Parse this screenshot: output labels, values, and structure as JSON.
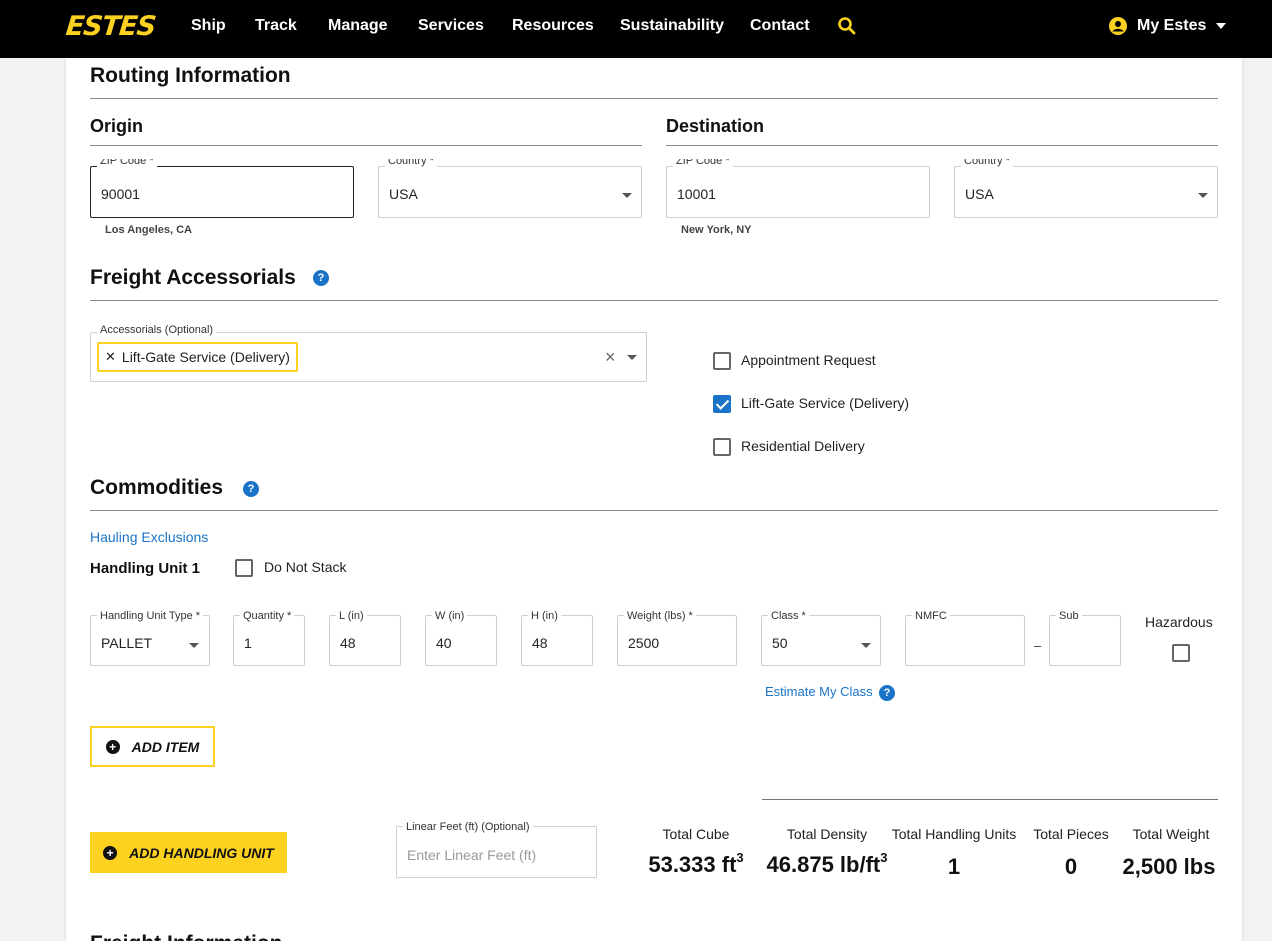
{
  "nav": {
    "logo": "ESTES",
    "links": [
      "Ship",
      "Track",
      "Manage",
      "Services",
      "Resources",
      "Sustainability",
      "Contact"
    ],
    "account_label": "My Estes",
    "accent": "#fdd11f"
  },
  "routing": {
    "title": "Routing Information",
    "origin": {
      "title": "Origin",
      "zip_label": "ZIP Code *",
      "zip_value": "90001",
      "zip_hint": "Los Angeles, CA",
      "country_label": "Country *",
      "country_value": "USA"
    },
    "destination": {
      "title": "Destination",
      "zip_label": "ZIP Code *",
      "zip_value": "10001",
      "zip_hint": "New York, NY",
      "country_label": "Country *",
      "country_value": "USA"
    }
  },
  "accessorials": {
    "title": "Freight Accessorials",
    "select_label": "Accessorials (Optional)",
    "selected_chips": [
      "Lift-Gate Service (Delivery)"
    ],
    "checkboxes": [
      {
        "label": "Appointment Request",
        "checked": false
      },
      {
        "label": "Lift-Gate Service (Delivery)",
        "checked": true
      },
      {
        "label": "Residential Delivery",
        "checked": false
      }
    ]
  },
  "commodities": {
    "title": "Commodities",
    "hauling_link": "Hauling Exclusions",
    "unit_title": "Handling Unit 1",
    "do_not_stack_label": "Do Not Stack",
    "fields": {
      "type": {
        "label": "Handling Unit Type *",
        "value": "PALLET"
      },
      "quantity": {
        "label": "Quantity *",
        "value": "1"
      },
      "length": {
        "label": "L (in)",
        "value": "48"
      },
      "width": {
        "label": "W (in)",
        "value": "40"
      },
      "height": {
        "label": "H (in)",
        "value": "48"
      },
      "weight": {
        "label": "Weight (lbs) *",
        "value": "2500"
      },
      "class": {
        "label": "Class *",
        "value": "50"
      },
      "nmfc": {
        "label": "NMFC",
        "value": ""
      },
      "sub": {
        "label": "Sub",
        "value": ""
      }
    },
    "nmfc_separator": "–",
    "hazardous_label": "Hazardous",
    "estimate_link": "Estimate My Class",
    "add_item_label": "ADD ITEM",
    "add_unit_label": "ADD HANDLING UNIT",
    "linear_feet": {
      "label": "Linear Feet (ft) (Optional)",
      "placeholder": "Enter Linear Feet (ft)"
    }
  },
  "totals": [
    {
      "label": "Total Cube",
      "value": "53.333 ft",
      "sup": "3"
    },
    {
      "label": "Total Density",
      "value": "46.875 lb/ft",
      "sup": "3"
    },
    {
      "label": "Total Handling Units",
      "value": "1",
      "sup": ""
    },
    {
      "label": "Total Pieces",
      "value": "0",
      "sup": ""
    },
    {
      "label": "Total Weight",
      "value": "2,500 lbs",
      "sup": ""
    }
  ],
  "next_section_title": "Freight Information"
}
